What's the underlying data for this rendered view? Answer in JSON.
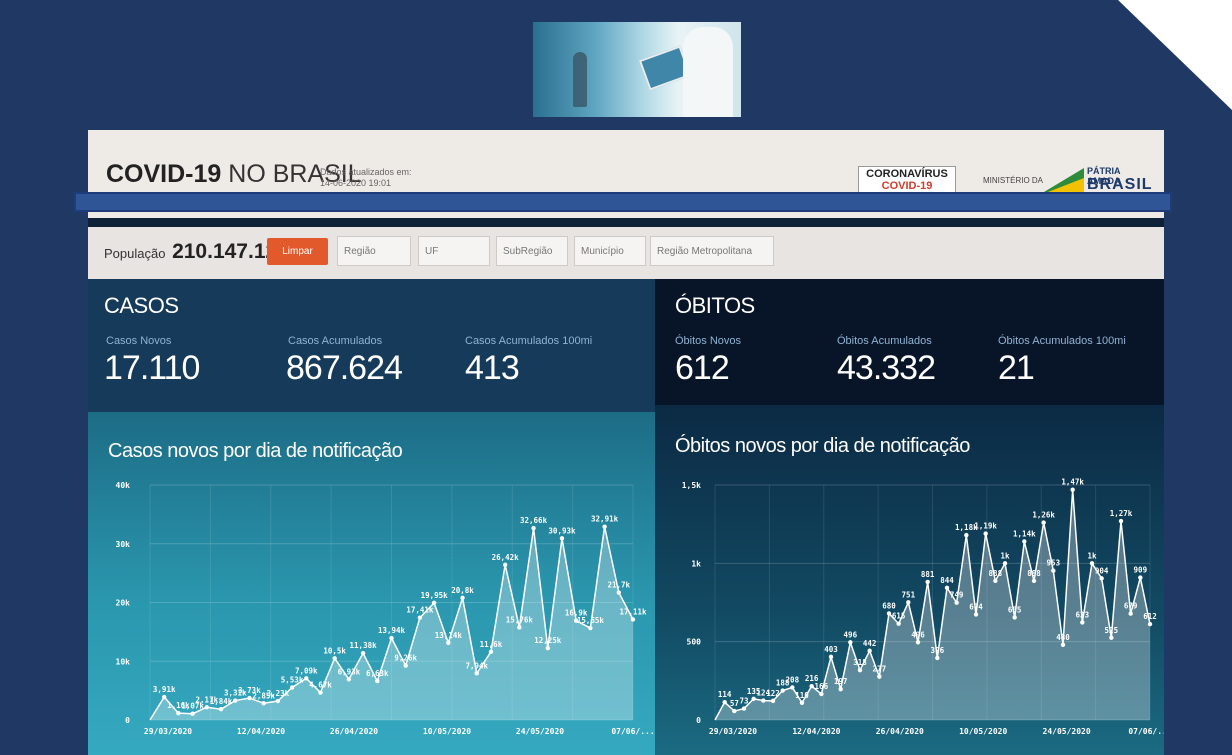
{
  "header": {
    "brand_bold": "COVID-19",
    "brand_rest": "NO BRASIL",
    "updated_label": "Dados atualizados em:",
    "updated_value": "14-06-2020 19:01",
    "corona_text": "CORONAVÍRUS",
    "corona_sub": "COVID-19",
    "ministerio": "MINISTÉRIO DA",
    "patria_line1": "PÁTRIA AMADA",
    "patria_line2": "BRASIL"
  },
  "filters": {
    "population_label": "População",
    "population_value": "210.147.125",
    "clear_button": "Limpar",
    "regiao": "Região",
    "uf": "UF",
    "subregiao": "SubRegião",
    "municipio": "Município",
    "regiao_metropolitana": "Região Metropolitana"
  },
  "casos": {
    "title": "CASOS",
    "novos_label": "Casos Novos",
    "novos_value": "17.110",
    "acumulados_label": "Casos Acumulados",
    "acumulados_value": "867.624",
    "acumulados100_label": "Casos Acumulados 100mi",
    "acumulados100_value": "413"
  },
  "obitos": {
    "title": "ÓBITOS",
    "novos_label": "Óbitos Novos",
    "novos_value": "612",
    "acumulados_label": "Óbitos Acumulados",
    "acumulados_value": "43.332",
    "acumulados100_label": "Óbitos Acumulados 100mi",
    "acumulados100_value": "21"
  },
  "colors": {
    "slide_background": "#1f3864",
    "clear_button": "#e25a2c"
  },
  "chart_data": [
    {
      "type": "area",
      "title": "Casos novos por dia de notificação",
      "ylim": [
        0,
        40000
      ],
      "yticks": [
        "0",
        "10k",
        "20k",
        "30k",
        "40k"
      ],
      "xticks": [
        "29/03/2020",
        "12/04/2020",
        "26/04/2020",
        "10/05/2020",
        "24/05/2020",
        "07/06/..."
      ],
      "values": [
        0,
        3910,
        1160,
        1070,
        2170,
        1840,
        3310,
        3730,
        2850,
        3230,
        5530,
        7090,
        4670,
        10500,
        6930,
        11380,
        6630,
        13940,
        9260,
        17410,
        19950,
        13140,
        20800,
        7940,
        11600,
        26420,
        15760,
        32660,
        12250,
        30930,
        16900,
        15650,
        32910,
        21700,
        17110
      ],
      "labels": [
        "",
        "3,91k",
        "1,16k",
        "1,07k",
        "2,17k",
        "1,84k",
        "3,31k",
        "3,73k",
        "2,85k",
        "3,23k",
        "5,53k",
        "7,09k",
        "4,67k",
        "10,5k",
        "6,93k",
        "11,38k",
        "6,63k",
        "13,94k",
        "9,26k",
        "17,41k",
        "19,95k",
        "13,14k",
        "20,8k",
        "7,94k",
        "11,6k",
        "26,42k",
        "15,76k",
        "32,66k",
        "12,25k",
        "30,93k",
        "16,9k",
        "15,65k",
        "32,91k",
        "21,7k",
        "17,11k"
      ]
    },
    {
      "type": "area",
      "title": "Óbitos novos por dia de notificação",
      "ylim": [
        0,
        1500
      ],
      "yticks": [
        "0",
        "500",
        "1k",
        "1,5k"
      ],
      "xticks": [
        "29/03/2020",
        "12/04/2020",
        "26/04/2020",
        "10/05/2020",
        "24/05/2020",
        "07/06/..."
      ],
      "values": [
        0,
        114,
        57,
        73,
        135,
        124,
        122,
        188,
        208,
        110,
        216,
        166,
        403,
        197,
        496,
        318,
        442,
        277,
        680,
        615,
        751,
        496,
        881,
        396,
        844,
        749,
        1180,
        674,
        1190,
        888,
        1000,
        655,
        1140,
        888,
        1260,
        953,
        480,
        1470,
        623,
        1000,
        904,
        525,
        1270,
        679,
        909,
        612
      ],
      "labels": [
        "",
        "114",
        "57",
        "73",
        "135",
        "124",
        "122",
        "188",
        "208",
        "110",
        "216",
        "166",
        "403",
        "197",
        "496",
        "318",
        "442",
        "277",
        "680",
        "615",
        "751",
        "496",
        "881",
        "396",
        "844",
        "749",
        "1,18k",
        "674",
        "1,19k",
        "888",
        "1k",
        "655",
        "1,14k",
        "888",
        "1,26k",
        "953",
        "480",
        "1,47k",
        "623",
        "1k",
        "904",
        "525",
        "1,27k",
        "679",
        "909",
        "612"
      ]
    }
  ]
}
